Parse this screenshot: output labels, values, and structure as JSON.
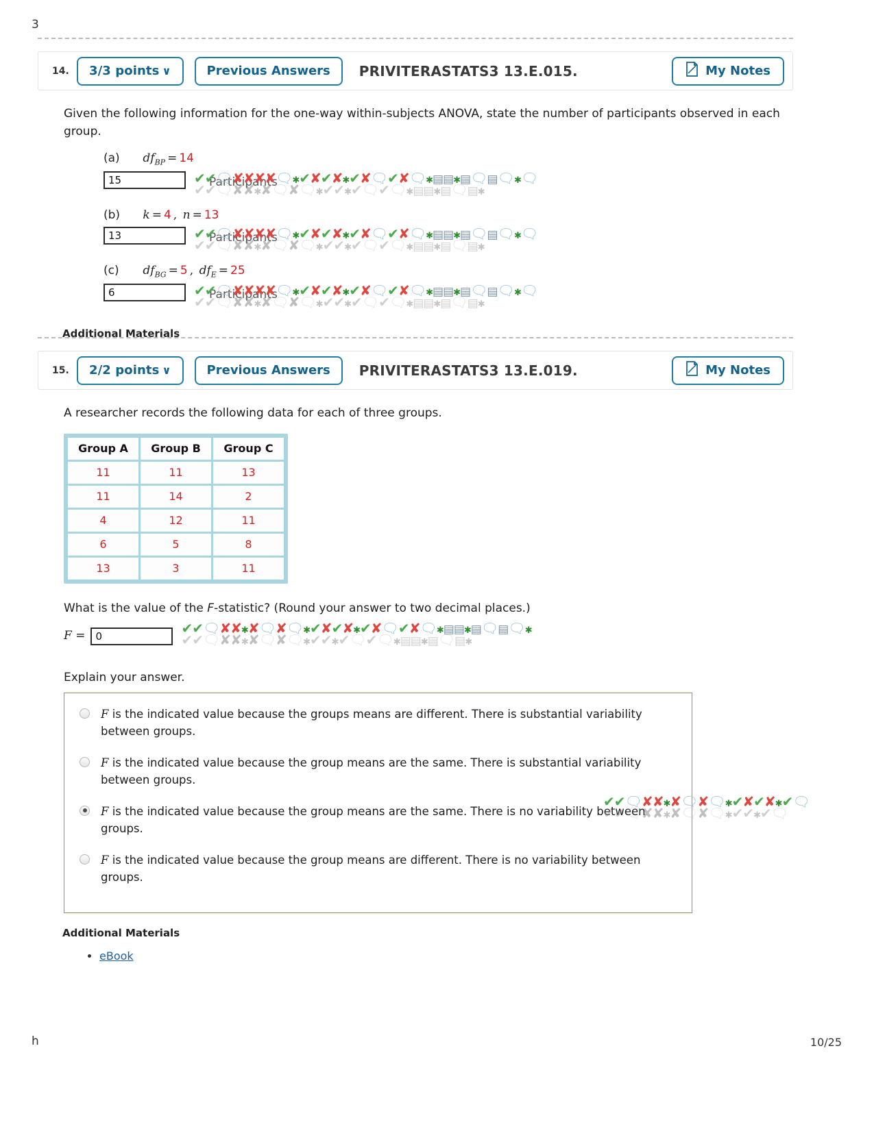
{
  "page": {
    "number_label": "10/25",
    "edge_top_left": "3",
    "edge_bottom_left": "h"
  },
  "questions": [
    {
      "number": "14.",
      "points_label": "3/3 points",
      "points_chevron": "∨",
      "previous_answers_label": "Previous Answers",
      "problem_id": "PRIVITERASTATS3 13.E.015.",
      "my_notes_label": "My Notes",
      "prompt": "Given the following information for the one-way within-subjects ANOVA, state the number of participants observed in each group.",
      "parts": [
        {
          "label": "(a)",
          "expr_plain": "df_BP = 14",
          "answer_value": "15",
          "ghost_word": "Participants"
        },
        {
          "label": "(b)",
          "expr_plain": "k = 4, n = 13",
          "answer_value": "13",
          "ghost_word": "Participants"
        },
        {
          "label": "(c)",
          "expr_plain": "df_BG = 5, df_E = 25",
          "answer_value": "6",
          "ghost_word": "Participants"
        }
      ],
      "additional_materials_label": "Additional Materials",
      "ebook_label": "eBook"
    },
    {
      "number": "15.",
      "points_label": "2/2 points",
      "points_chevron": "∨",
      "previous_answers_label": "Previous Answers",
      "problem_id": "PRIVITERASTATS3 13.E.019.",
      "my_notes_label": "My Notes",
      "prompt": "A researcher records the following data for each of three groups.",
      "fstat_question": "What is the value of the F-statistic? (Round your answer to two decimal places.)",
      "fstat_label": "F =",
      "fstat_value": "0",
      "explain_label": "Explain your answer.",
      "options": [
        {
          "text": "F is the indicated value because the groups means are different. There is substantial variability between groups.",
          "selected": false
        },
        {
          "text": "F is the indicated value because the group means are the same. There is substantial variability between groups.",
          "selected": false
        },
        {
          "text": "F is the indicated value because the group means are the same. There is no variability between groups.",
          "selected": true
        },
        {
          "text": "F is the indicated value because the group means are different. There is no variability between groups.",
          "selected": false
        }
      ],
      "additional_materials_label": "Additional Materials",
      "ebook_label": "eBook"
    }
  ],
  "table": {
    "headers": [
      "Group A",
      "Group B",
      "Group C"
    ],
    "rows": [
      [
        "11",
        "11",
        "13"
      ],
      [
        "11",
        "14",
        "2"
      ],
      [
        "4",
        "12",
        "11"
      ],
      [
        "6",
        "5",
        "8"
      ],
      [
        "13",
        "3",
        "11"
      ]
    ]
  },
  "colors": {
    "accent_blue": "#13628c",
    "border_blue": "#1f7fa5",
    "answer_red": "#d61f20",
    "table_border": "#a9d5e0",
    "options_border": "#7d9e59",
    "link_blue": "#1a5fa8"
  },
  "math": {
    "a_df": "df",
    "a_sub": "BP",
    "a_val": "14",
    "b_k": "k",
    "b_k_val": "4",
    "b_n": "n",
    "b_n_val": "13",
    "c_df1": "df",
    "c_sub1": "BG",
    "c_val1": "5",
    "c_df2": "df",
    "c_sub2": "E",
    "c_val2": "25"
  }
}
